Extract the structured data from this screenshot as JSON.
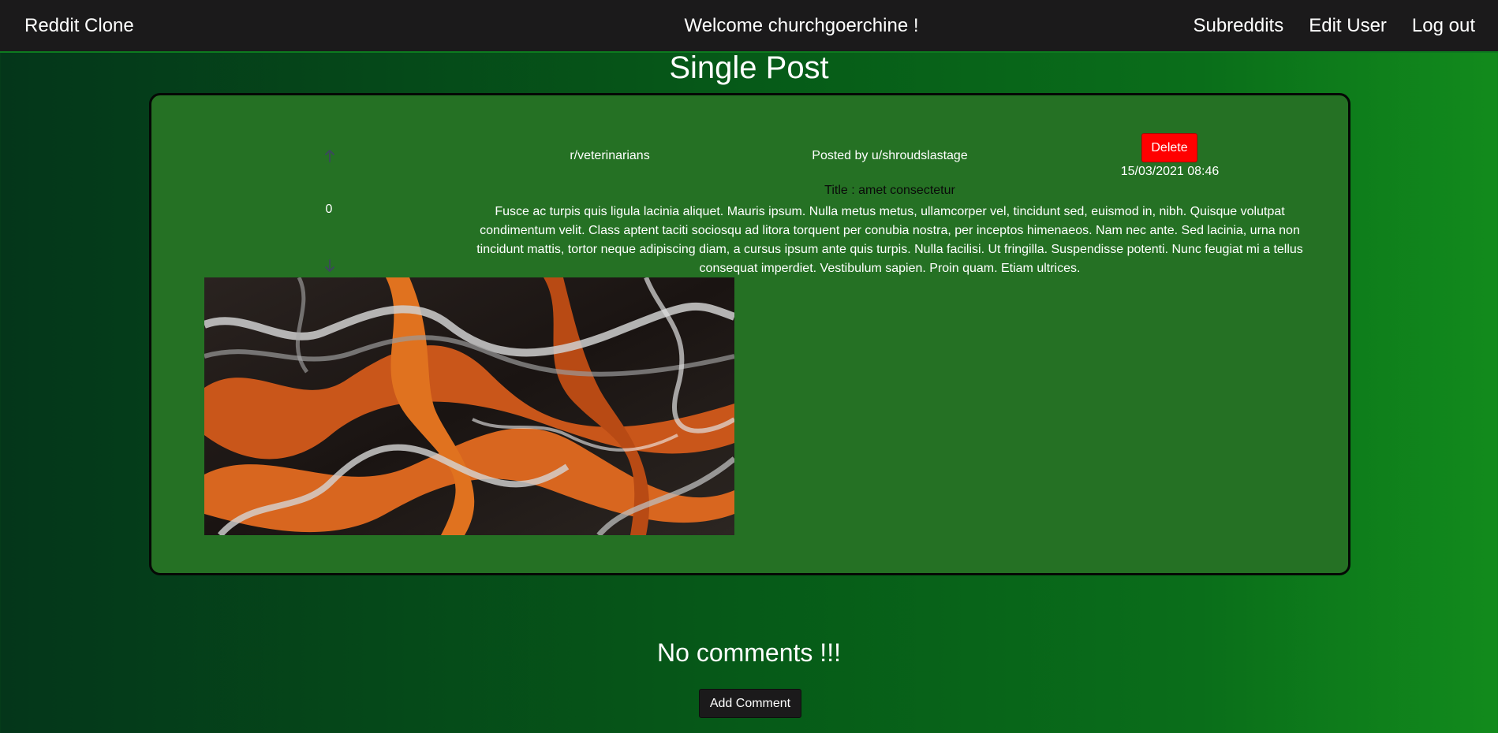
{
  "navbar": {
    "brand": "Reddit Clone",
    "welcome": "Welcome churchgoerchine !",
    "links": {
      "subreddits": "Subreddits",
      "edit_user": "Edit User",
      "log_out": "Log out"
    }
  },
  "page": {
    "title": "Single Post"
  },
  "post": {
    "vote_count": "0",
    "upvote_icon": "arrow-up-icon",
    "downvote_icon": "arrow-down-icon",
    "subreddit": "r/veterinarians",
    "posted_by": "Posted by u/shroudslastage",
    "delete_label": "Delete",
    "date": "15/03/2021 08:46",
    "title": "Title : amet consectetur",
    "body": "Fusce ac turpis quis ligula lacinia aliquet. Mauris ipsum. Nulla metus metus, ullamcorper vel, tincidunt sed, euismod in, nibh. Quisque volutpat condimentum velit. Class aptent taciti sociosqu ad litora torquent per conubia nostra, per inceptos himenaeos. Nam nec ante. Sed lacinia, urna non tincidunt mattis, tortor neque adipiscing diam, a cursus ipsum ante quis turpis. Nulla facilisi. Ut fringilla. Suspendisse potenti. Nunc feugiat mi a tellus consequat imperdiet. Vestibulum sapien. Proin quam. Etiam ultrices."
  },
  "comments": {
    "empty_message": "No comments !!!",
    "add_label": "Add Comment"
  },
  "colors": {
    "navbar_bg": "#1b1a1b",
    "card_bg": "#257124",
    "delete": "#ff0000",
    "vote_arrow": "#3a4a5a"
  }
}
